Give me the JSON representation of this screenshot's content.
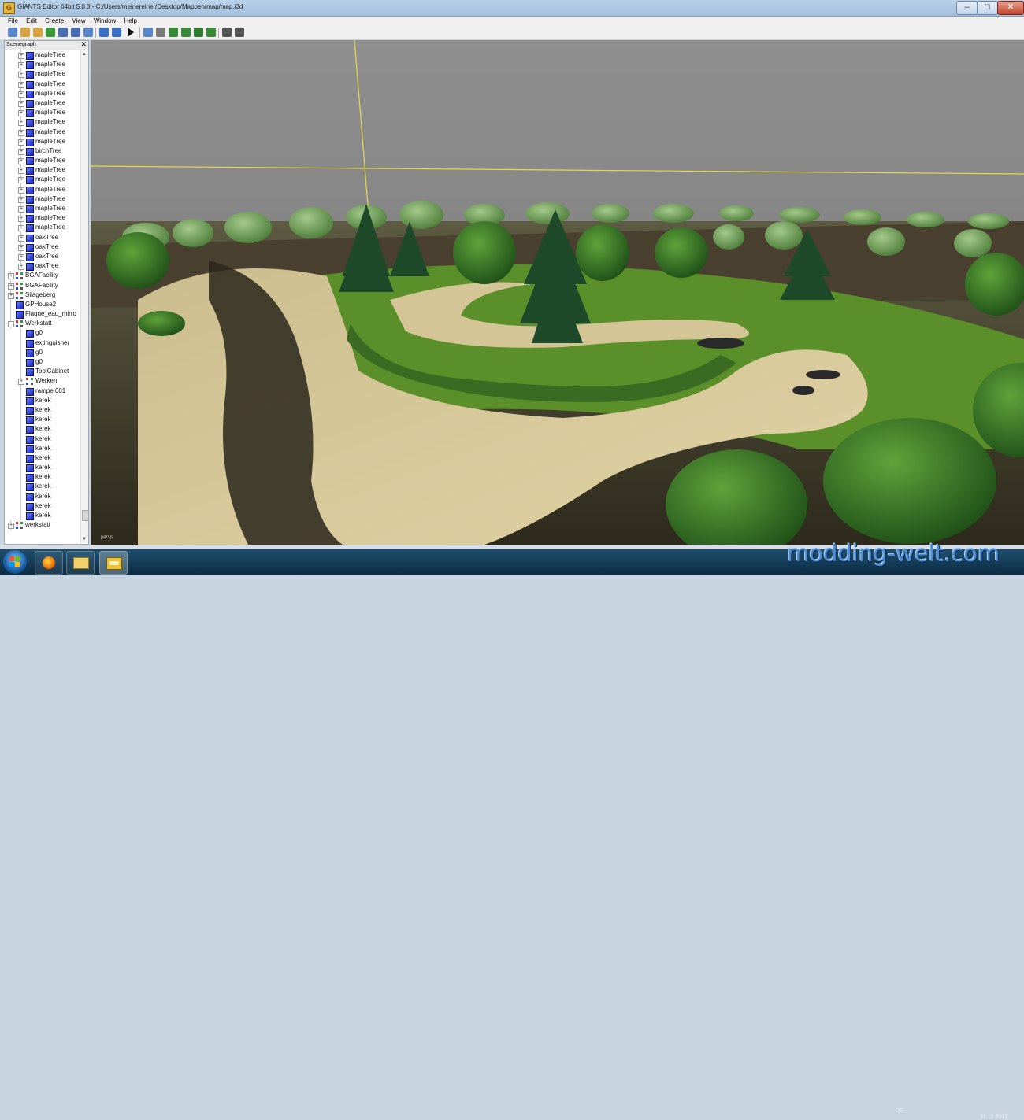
{
  "window": {
    "title": "GIANTS Editor 64bit 5.0.3 - C:/Users/meinereiner/Desktop/Mappen/map/map.i3d",
    "app_icon_glyph": "G",
    "minimize_glyph": "–",
    "maximize_glyph": "□",
    "close_glyph": "✕"
  },
  "menu": [
    "File",
    "Edit",
    "Create",
    "View",
    "Window",
    "Help"
  ],
  "toolbar": {
    "icons": [
      "new-icon",
      "open-icon",
      "open-recent-icon",
      "refresh-icon",
      "save-icon",
      "save-as-icon",
      "import-icon",
      "undo-icon",
      "redo-icon",
      "play-icon",
      "select-tool-icon",
      "move-tool-icon",
      "terrain-sculpt-icon",
      "terrain-paint-icon",
      "foliage-paint-icon",
      "decoration-paint-icon",
      "settings-icon",
      "stats-icon"
    ]
  },
  "scenegraph": {
    "title": "Scenegraph",
    "close_glyph": "✕",
    "items": [
      {
        "label": "mapleTree",
        "depth": 2,
        "icon": "cube",
        "expander": "+"
      },
      {
        "label": "mapleTree",
        "depth": 2,
        "icon": "cube",
        "expander": "+"
      },
      {
        "label": "mapleTree",
        "depth": 2,
        "icon": "cube",
        "expander": "+"
      },
      {
        "label": "mapleTree",
        "depth": 2,
        "icon": "cube",
        "expander": "+"
      },
      {
        "label": "mapleTree",
        "depth": 2,
        "icon": "cube",
        "expander": "+"
      },
      {
        "label": "mapleTree",
        "depth": 2,
        "icon": "cube",
        "expander": "+"
      },
      {
        "label": "mapleTree",
        "depth": 2,
        "icon": "cube",
        "expander": "+"
      },
      {
        "label": "mapleTree",
        "depth": 2,
        "icon": "cube",
        "expander": "+"
      },
      {
        "label": "mapleTree",
        "depth": 2,
        "icon": "cube",
        "expander": "+"
      },
      {
        "label": "mapleTree",
        "depth": 2,
        "icon": "cube",
        "expander": "+"
      },
      {
        "label": "birchTree",
        "depth": 2,
        "icon": "cube",
        "expander": "+"
      },
      {
        "label": "mapleTree",
        "depth": 2,
        "icon": "cube",
        "expander": "+"
      },
      {
        "label": "mapleTree",
        "depth": 2,
        "icon": "cube",
        "expander": "+"
      },
      {
        "label": "mapleTree",
        "depth": 2,
        "icon": "cube",
        "expander": "+"
      },
      {
        "label": "mapleTree",
        "depth": 2,
        "icon": "cube",
        "expander": "+"
      },
      {
        "label": "mapleTree",
        "depth": 2,
        "icon": "cube",
        "expander": "+"
      },
      {
        "label": "mapleTree",
        "depth": 2,
        "icon": "cube",
        "expander": "+"
      },
      {
        "label": "mapleTree",
        "depth": 2,
        "icon": "cube",
        "expander": "+"
      },
      {
        "label": "mapleTree",
        "depth": 2,
        "icon": "cube",
        "expander": "+"
      },
      {
        "label": "oakTree",
        "depth": 2,
        "icon": "cube",
        "expander": "+"
      },
      {
        "label": "oakTree",
        "depth": 2,
        "icon": "cube",
        "expander": "+"
      },
      {
        "label": "oakTree",
        "depth": 2,
        "icon": "cube",
        "expander": "+"
      },
      {
        "label": "oakTree",
        "depth": 2,
        "icon": "cube",
        "expander": "+"
      },
      {
        "label": "BGAFacility",
        "depth": 1,
        "icon": "group",
        "expander": "+"
      },
      {
        "label": "BGAFacility",
        "depth": 1,
        "icon": "group",
        "expander": "+"
      },
      {
        "label": "Silageberg",
        "depth": 1,
        "icon": "group",
        "expander": "+"
      },
      {
        "label": "GPHouse2",
        "depth": 1,
        "icon": "cube",
        "expander": ""
      },
      {
        "label": "Flaque_eau_mirro",
        "depth": 1,
        "icon": "cube",
        "expander": ""
      },
      {
        "label": "Werkstatt",
        "depth": 1,
        "icon": "group",
        "expander": "−"
      },
      {
        "label": "g0",
        "depth": 2,
        "icon": "cube",
        "expander": ""
      },
      {
        "label": "extinguisher",
        "depth": 2,
        "icon": "cube",
        "expander": ""
      },
      {
        "label": "g0",
        "depth": 2,
        "icon": "cube",
        "expander": ""
      },
      {
        "label": "g0",
        "depth": 2,
        "icon": "cube",
        "expander": ""
      },
      {
        "label": "ToolCabinet",
        "depth": 2,
        "icon": "cube",
        "expander": ""
      },
      {
        "label": "Werken",
        "depth": 2,
        "icon": "group",
        "expander": "+"
      },
      {
        "label": "rampe.001",
        "depth": 2,
        "icon": "cube",
        "expander": ""
      },
      {
        "label": "kerek",
        "depth": 2,
        "icon": "cube",
        "expander": ""
      },
      {
        "label": "kerek",
        "depth": 2,
        "icon": "cube",
        "expander": ""
      },
      {
        "label": "kerek",
        "depth": 2,
        "icon": "cube",
        "expander": ""
      },
      {
        "label": "kerek",
        "depth": 2,
        "icon": "cube",
        "expander": ""
      },
      {
        "label": "kerek",
        "depth": 2,
        "icon": "cube",
        "expander": ""
      },
      {
        "label": "kerek",
        "depth": 2,
        "icon": "cube",
        "expander": ""
      },
      {
        "label": "kerek",
        "depth": 2,
        "icon": "cube",
        "expander": ""
      },
      {
        "label": "kerek",
        "depth": 2,
        "icon": "cube",
        "expander": ""
      },
      {
        "label": "kerek",
        "depth": 2,
        "icon": "cube",
        "expander": ""
      },
      {
        "label": "kerek",
        "depth": 2,
        "icon": "cube",
        "expander": ""
      },
      {
        "label": "kerek",
        "depth": 2,
        "icon": "cube",
        "expander": ""
      },
      {
        "label": "kerek",
        "depth": 2,
        "icon": "cube",
        "expander": ""
      },
      {
        "label": "kerek",
        "depth": 2,
        "icon": "cube",
        "expander": ""
      },
      {
        "label": "werkstatt",
        "depth": 1,
        "icon": "group",
        "expander": "+"
      }
    ]
  },
  "viewport": {
    "camera_label": "persp",
    "colors": {
      "sky": "#8c8c8c",
      "sand": "#d6c79a",
      "grass": "#4c8a2a",
      "axis": "#e8d84a"
    }
  },
  "taskbar": {
    "apps": [
      "start-orb-icon",
      "firefox-icon",
      "explorer-icon",
      "giants-editor-icon"
    ],
    "language": "DE",
    "date": "31.12.2013"
  },
  "watermark": "modding-welt.com"
}
